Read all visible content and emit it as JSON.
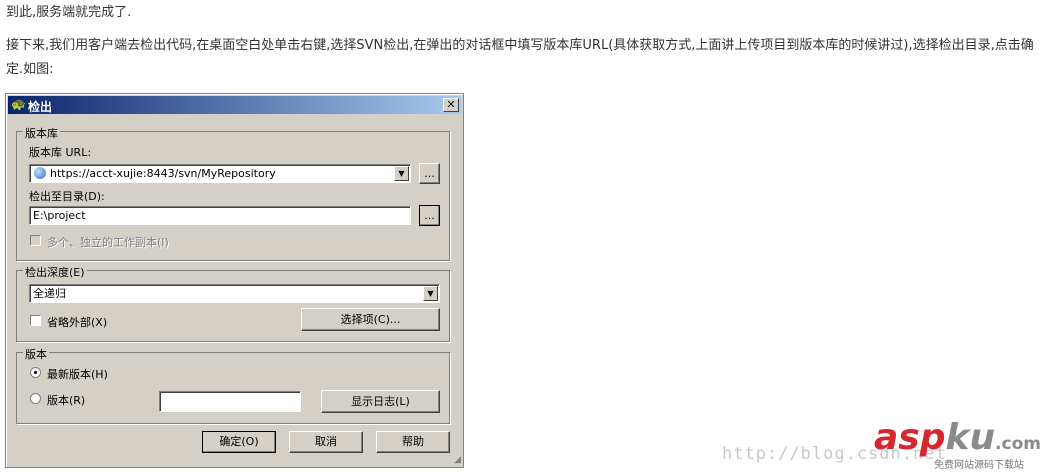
{
  "article": {
    "line1": "到此,服务端就完成了.",
    "paragraph": "接下来,我们用客户端去检出代码,在桌面空白处单击右键,选择SVN检出,在弹出的对话框中填写版本库URL(具体获取方式,上面讲上传项目到版本库的时候讲过),选择检出目录,点击确定.如图:"
  },
  "dialog": {
    "title": "检出",
    "close_glyph": "✕",
    "repo_group": {
      "legend": "版本库",
      "url_label": "版本库 URL:",
      "url_value": "https://acct-xujie:8443/svn/MyRepository",
      "browse_label": "...",
      "dir_label": "检出至目录(D):",
      "dir_value": "E:\\project",
      "browse_dir_label": "...",
      "multi_checkbox_label": "多个、独立的工作副本(I)"
    },
    "depth_group": {
      "legend": "检出深度(E)",
      "depth_value": "全递归",
      "omit_externals_label": "省略外部(X)",
      "options_button": "选择项(C)..."
    },
    "revision_group": {
      "legend": "版本",
      "head_label": "最新版本(H)",
      "revision_label": "版本(R)",
      "revision_value": "",
      "show_log_button": "显示日志(L)"
    },
    "buttons": {
      "ok": "确定(O)",
      "cancel": "取消",
      "help": "帮助"
    }
  },
  "watermark": {
    "url": "http://blog.csdn.net",
    "logo_asp": "asp",
    "logo_ku": "ku",
    "logo_com": ".com",
    "sub": "免费网站源码下载站"
  },
  "colors": {
    "title_gradient_start": "#0a246a",
    "title_gradient_end": "#a6caf0",
    "dialog_face": "#d4d0c8",
    "logo_red": "#d8262e"
  }
}
